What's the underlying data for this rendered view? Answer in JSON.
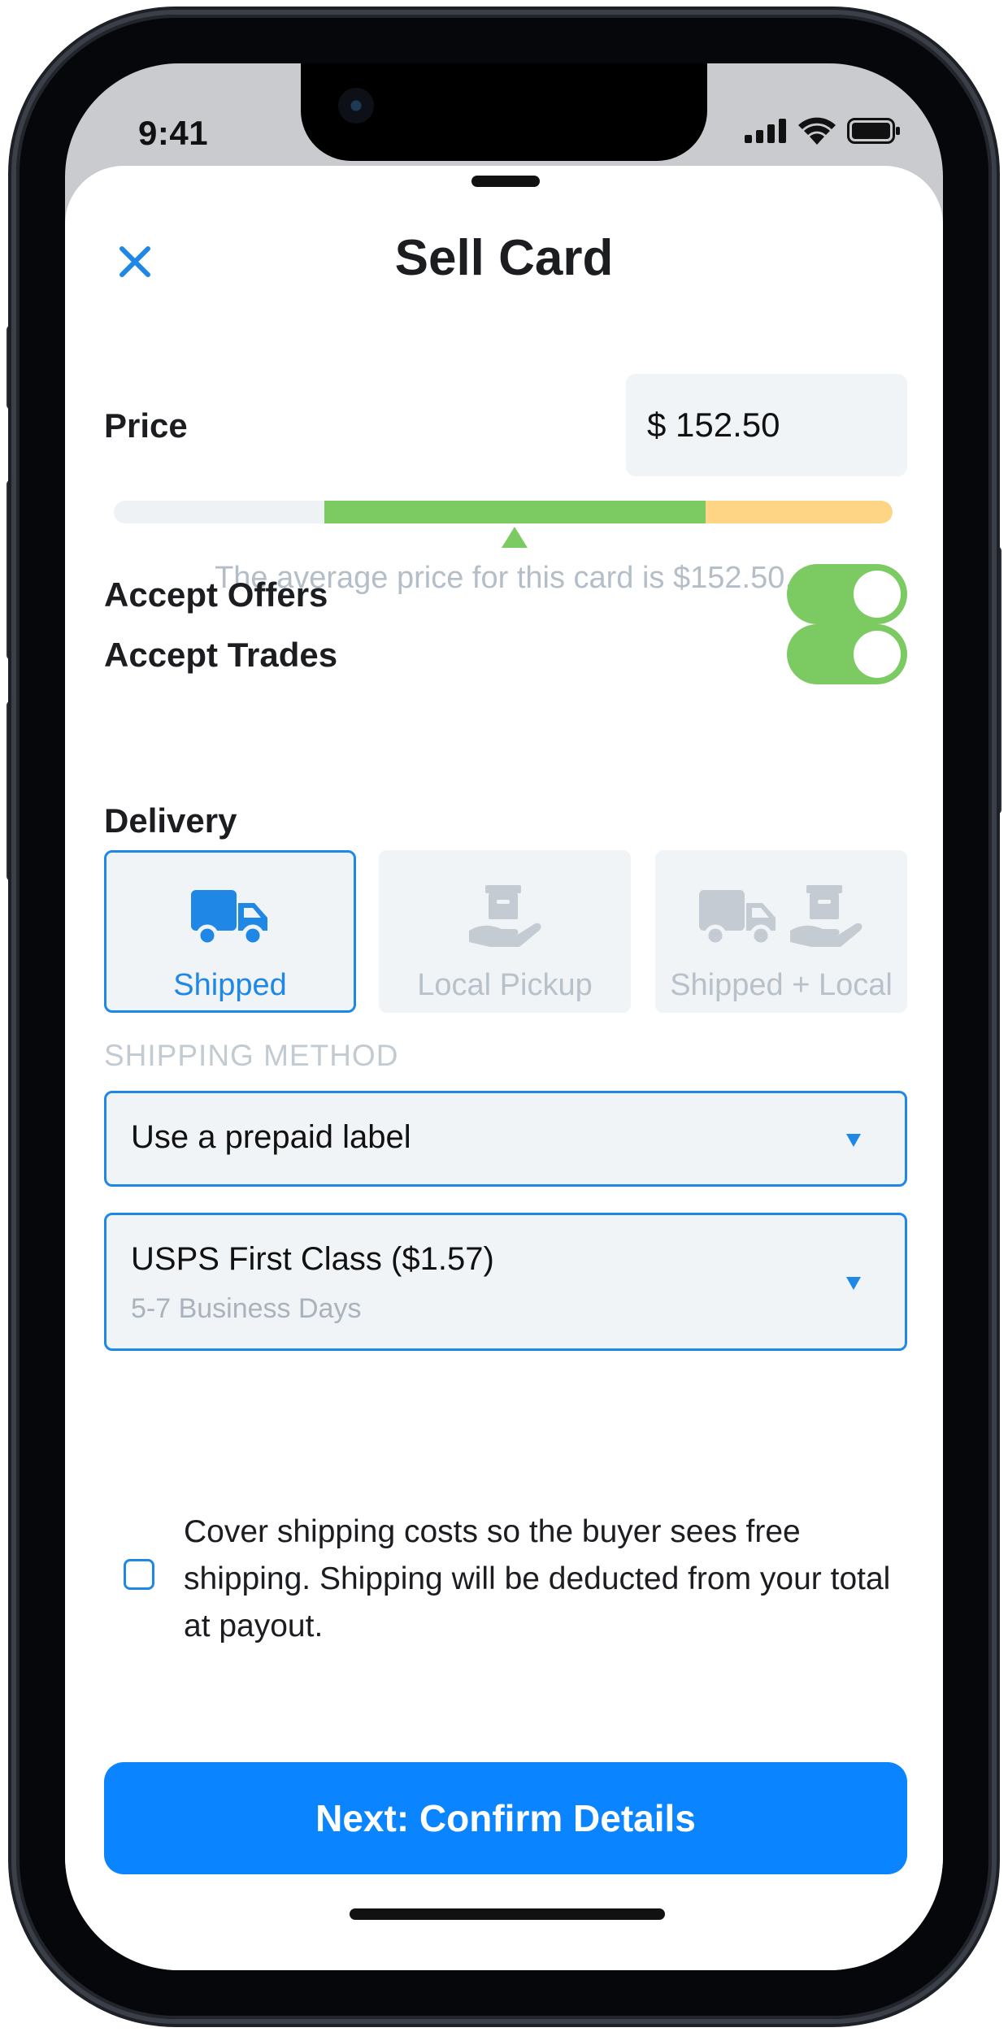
{
  "status_bar": {
    "time": "9:41"
  },
  "header": {
    "title": "Sell Card"
  },
  "price": {
    "label": "Price",
    "value": "$ 152.50",
    "range": {
      "green_start": 0.27,
      "green_end": 0.76,
      "yellow_end": 1.0,
      "marker": 0.515
    },
    "average_text": "The average price for this card is $152.50."
  },
  "options": [
    {
      "label": "Accept Offers",
      "enabled": true
    },
    {
      "label": "Accept Trades",
      "enabled": true
    }
  ],
  "delivery": {
    "label": "Delivery",
    "choices": [
      {
        "label": "Shipped",
        "icons": [
          "truck-icon"
        ],
        "selected": true
      },
      {
        "label": "Local Pickup",
        "icons": [
          "hand-box-icon"
        ],
        "selected": false
      },
      {
        "label": "Shipped + Local",
        "icons": [
          "truck-icon",
          "hand-box-icon"
        ],
        "selected": false
      }
    ]
  },
  "shipping": {
    "caption": "SHIPPING METHOD",
    "method_select": {
      "value": "Use a prepaid label"
    },
    "service_select": {
      "value": "USPS First Class ($1.57)",
      "subtext": "5-7 Business Days"
    }
  },
  "cover_shipping": {
    "checked": false,
    "text": "Cover shipping costs so the buyer sees free shipping. Shipping will be deducted from your total at payout."
  },
  "cta": {
    "label": "Next: Confirm Details"
  },
  "colors": {
    "accent": "#0a84ff",
    "selected_border": "#1f87e5",
    "toggle_on": "#7ccb62",
    "range_green": "#7ccb62",
    "range_yellow": "#fdd585",
    "muted_text": "#b4bec8"
  }
}
